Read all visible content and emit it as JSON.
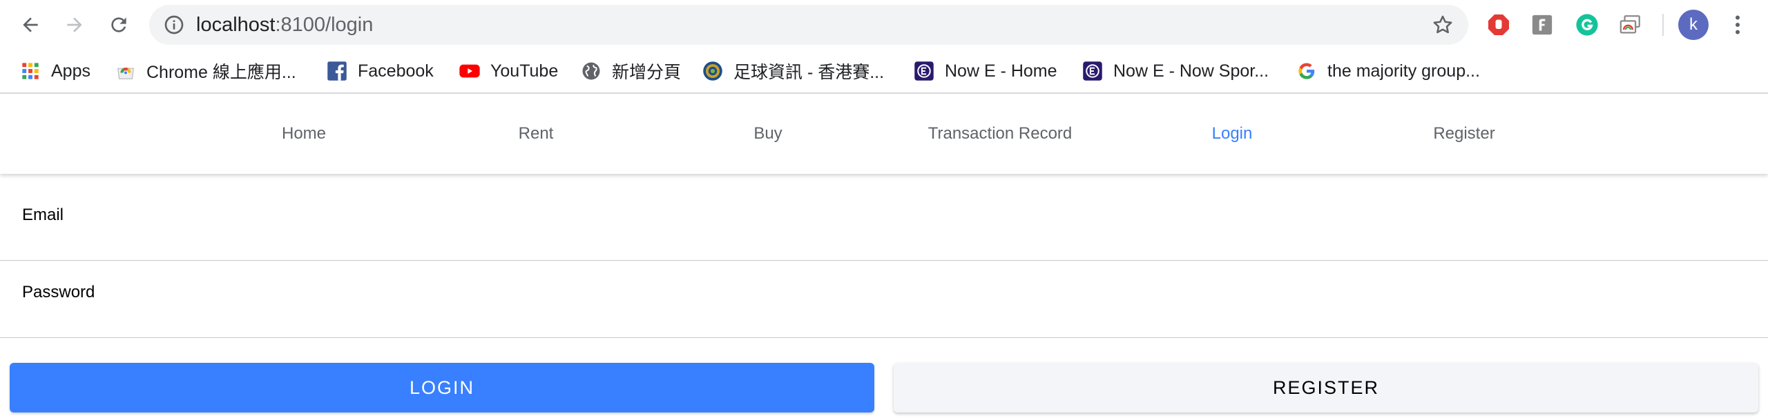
{
  "browser": {
    "url_host": "localhost",
    "url_path": ":8100/login",
    "profile_initial": "k",
    "colors": {
      "omnibox_bg": "#f1f3f4",
      "avatar": "#5c6bc0"
    },
    "extensions": [
      "adblock-icon",
      "flash-icon",
      "grammarly-icon",
      "cast-icon"
    ]
  },
  "bookmarks": [
    {
      "label": "Apps",
      "icon": "apps-grid-icon"
    },
    {
      "label": "Chrome 線上應用...",
      "icon": "chrome-webstore-icon"
    },
    {
      "label": "Facebook",
      "icon": "facebook-icon"
    },
    {
      "label": "YouTube",
      "icon": "youtube-icon"
    },
    {
      "label": "新增分頁",
      "icon": "globe-icon"
    },
    {
      "label": "足球資訊 - 香港賽...",
      "icon": "hkjc-icon"
    },
    {
      "label": "Now E - Home",
      "icon": "now-e-icon"
    },
    {
      "label": "Now E - Now Spor...",
      "icon": "now-e-icon"
    },
    {
      "label": "the majority group...",
      "icon": "google-icon"
    }
  ],
  "nav": {
    "tabs": [
      "Home",
      "Rent",
      "Buy",
      "Transaction Record",
      "Login",
      "Register"
    ],
    "active": "Login",
    "colors": {
      "active": "#3880ff",
      "inactive": "#5f6368"
    }
  },
  "form": {
    "email_label": "Email",
    "password_label": "Password",
    "email_value": "",
    "password_value": ""
  },
  "buttons": {
    "login": "LOGIN",
    "register": "REGISTER",
    "colors": {
      "login_bg": "#3880ff",
      "register_bg": "#f4f5f8"
    }
  }
}
